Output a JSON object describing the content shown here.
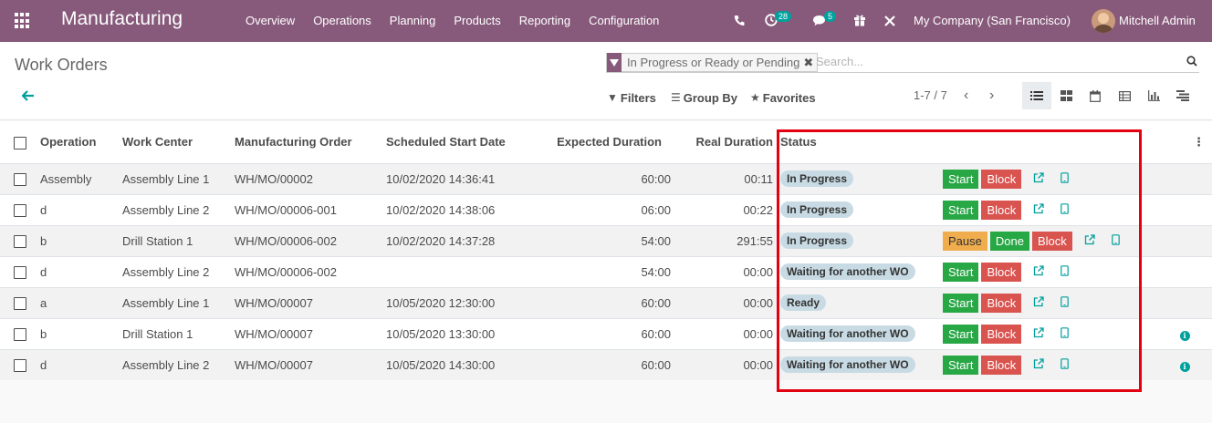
{
  "navbar": {
    "brand": "Manufacturing",
    "menu": [
      "Overview",
      "Operations",
      "Planning",
      "Products",
      "Reporting",
      "Configuration"
    ],
    "activity_badge": "28",
    "message_badge": "5",
    "company": "My Company (San Francisco)",
    "user": "Mitchell Admin"
  },
  "control": {
    "title": "Work Orders",
    "facet": "In Progress or Ready or Pending",
    "search_placeholder": "Search...",
    "filters_label": "Filters",
    "groupby_label": "Group By",
    "favorites_label": "Favorites",
    "pager": "1-7 / 7"
  },
  "table": {
    "headers": {
      "operation": "Operation",
      "work_center": "Work Center",
      "mo": "Manufacturing Order",
      "start": "Scheduled Start Date",
      "expected": "Expected Duration",
      "real": "Real Duration",
      "status": "Status"
    },
    "buttons": {
      "start": "Start",
      "block": "Block",
      "pause": "Pause",
      "done": "Done"
    },
    "rows": [
      {
        "operation": "Assembly",
        "work_center": "Assembly Line 1",
        "mo": "WH/MO/00002",
        "start": "10/02/2020 14:36:41",
        "expected": "60:00",
        "real": "00:11",
        "status": "In Progress",
        "actions": "start",
        "info": false
      },
      {
        "operation": "d",
        "work_center": "Assembly Line 2",
        "mo": "WH/MO/00006-001",
        "start": "10/02/2020 14:38:06",
        "expected": "06:00",
        "real": "00:22",
        "status": "In Progress",
        "actions": "start",
        "info": false
      },
      {
        "operation": "b",
        "work_center": "Drill Station 1",
        "mo": "WH/MO/00006-002",
        "start": "10/02/2020 14:37:28",
        "expected": "54:00",
        "real": "291:55",
        "status": "In Progress",
        "actions": "pause",
        "info": false
      },
      {
        "operation": "d",
        "work_center": "Assembly Line 2",
        "mo": "WH/MO/00006-002",
        "start": "",
        "expected": "54:00",
        "real": "00:00",
        "status": "Waiting for another WO",
        "actions": "start",
        "info": false
      },
      {
        "operation": "a",
        "work_center": "Assembly Line 1",
        "mo": "WH/MO/00007",
        "start": "10/05/2020 12:30:00",
        "expected": "60:00",
        "real": "00:00",
        "status": "Ready",
        "actions": "start",
        "info": false
      },
      {
        "operation": "b",
        "work_center": "Drill Station 1",
        "mo": "WH/MO/00007",
        "start": "10/05/2020 13:30:00",
        "expected": "60:00",
        "real": "00:00",
        "status": "Waiting for another WO",
        "actions": "start",
        "info": true
      },
      {
        "operation": "d",
        "work_center": "Assembly Line 2",
        "mo": "WH/MO/00007",
        "start": "10/05/2020 14:30:00",
        "expected": "60:00",
        "real": "00:00",
        "status": "Waiting for another WO",
        "actions": "start",
        "info": true
      }
    ]
  },
  "colors": {
    "brand": "#875a7b",
    "accent": "#00a09d",
    "start": "#28a745",
    "block": "#d9534f",
    "pause": "#f0ad4e",
    "highlight": "#e3000f"
  }
}
